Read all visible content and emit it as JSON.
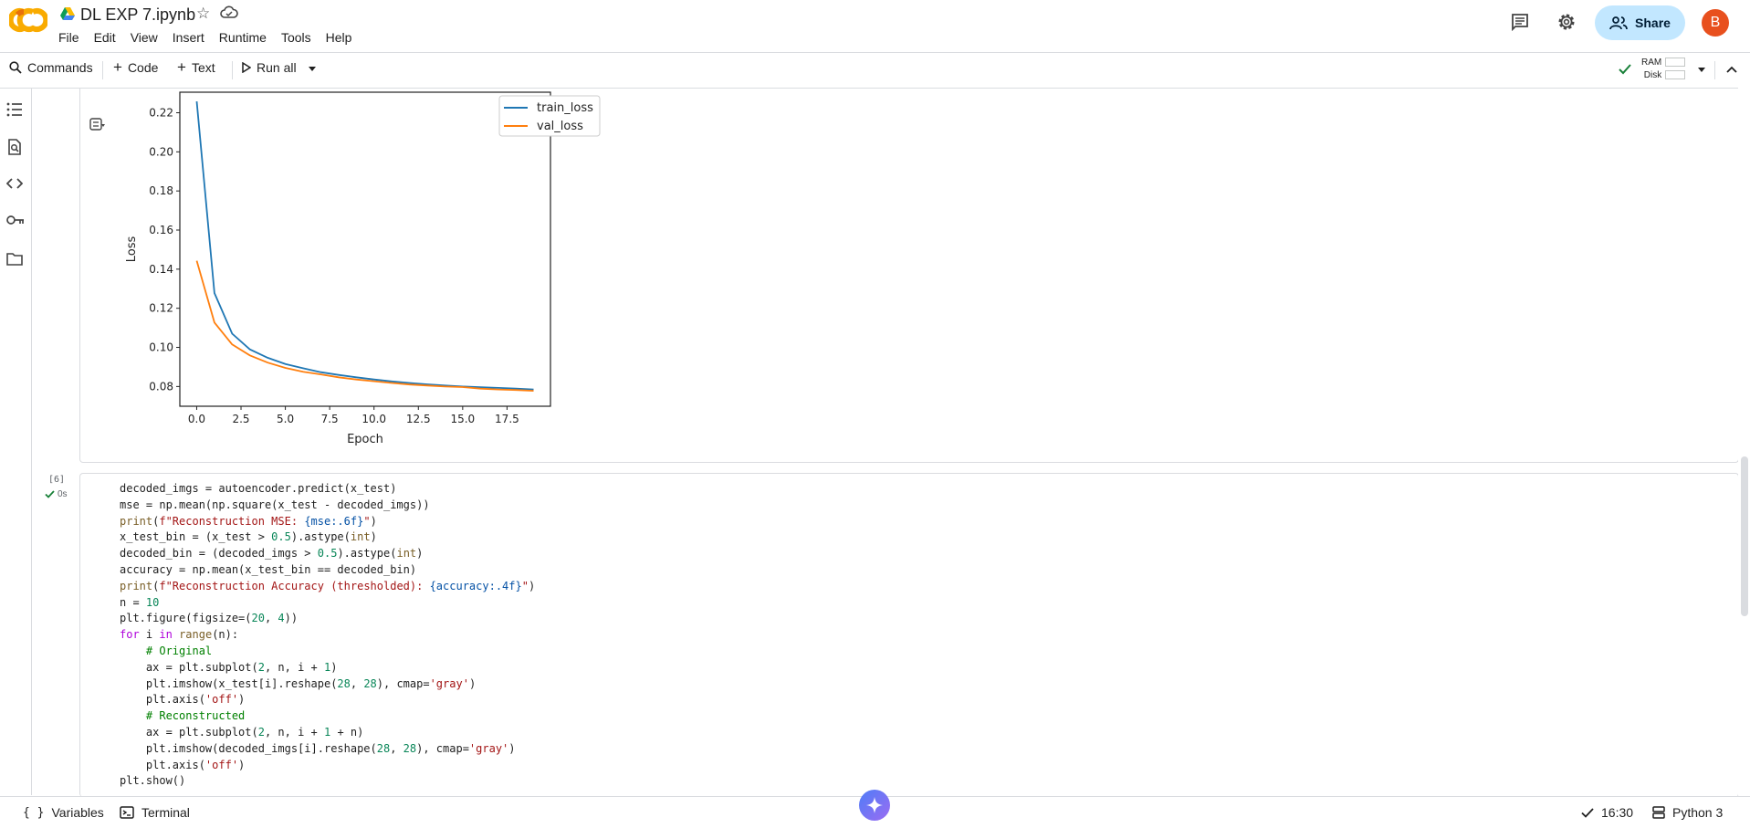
{
  "header": {
    "title": "DL EXP 7.ipynb",
    "menu": [
      "File",
      "Edit",
      "View",
      "Insert",
      "Runtime",
      "Tools",
      "Help"
    ],
    "share_label": "Share",
    "avatar_letter": "B"
  },
  "toolbar": {
    "commands": "Commands",
    "code": "Code",
    "text": "Text",
    "run_all": "Run all",
    "ram": "RAM",
    "disk": "Disk"
  },
  "cell": {
    "count": "[6]",
    "time": "0s"
  },
  "code_lines": [
    "decoded_imgs = autoencoder.predict(x_test)",
    "mse = np.mean(np.square(x_test - decoded_imgs))",
    "print(f\"Reconstruction MSE: {mse:.6f}\")",
    "x_test_bin = (x_test > 0.5).astype(int)",
    "decoded_bin = (decoded_imgs > 0.5).astype(int)",
    "accuracy = np.mean(x_test_bin == decoded_bin)",
    "print(f\"Reconstruction Accuracy (thresholded): {accuracy:.4f}\")",
    "n = 10",
    "plt.figure(figsize=(20, 4))",
    "for i in range(n):",
    "    # Original",
    "    ax = plt.subplot(2, n, i + 1)",
    "    plt.imshow(x_test[i].reshape(28, 28), cmap='gray')",
    "    plt.axis('off')",
    "    # Reconstructed",
    "    ax = plt.subplot(2, n, i + 1 + n)",
    "    plt.imshow(decoded_imgs[i].reshape(28, 28), cmap='gray')",
    "    plt.axis('off')",
    "plt.show()"
  ],
  "statusbar": {
    "variables": "Variables",
    "terminal": "Terminal",
    "time": "16:30",
    "runtime": "Python 3"
  },
  "colors": {
    "train": "#1f77b4",
    "val": "#ff7f0e",
    "share_bg": "#c2e7ff",
    "avatar_bg": "#e8501e"
  },
  "chart_data": {
    "type": "line",
    "xlabel": "Epoch",
    "ylabel": "Loss",
    "xlim": [
      -0.95,
      19.95
    ],
    "ylim": [
      0.0699,
      0.2305
    ],
    "xticks": [
      0.0,
      2.5,
      5.0,
      7.5,
      10.0,
      12.5,
      15.0,
      17.5
    ],
    "xtick_labels": [
      "0.0",
      "2.5",
      "5.0",
      "7.5",
      "10.0",
      "12.5",
      "15.0",
      "17.5"
    ],
    "yticks": [
      0.08,
      0.1,
      0.12,
      0.14,
      0.16,
      0.18,
      0.2,
      0.22
    ],
    "ytick_labels": [
      "0.08",
      "0.10",
      "0.12",
      "0.14",
      "0.16",
      "0.18",
      "0.20",
      "0.22"
    ],
    "legend_position": "top-right",
    "grid": false,
    "x": [
      0,
      1,
      2,
      3,
      4,
      5,
      6,
      7,
      8,
      9,
      10,
      11,
      12,
      13,
      14,
      15,
      16,
      17,
      18,
      19
    ],
    "series": [
      {
        "name": "train_loss",
        "values": [
          0.2258,
          0.1278,
          0.107,
          0.099,
          0.0947,
          0.0915,
          0.0893,
          0.0873,
          0.0859,
          0.0847,
          0.0836,
          0.0826,
          0.0818,
          0.0811,
          0.0805,
          0.08,
          0.0796,
          0.0793,
          0.0789,
          0.0785
        ]
      },
      {
        "name": "val_loss",
        "values": [
          0.1443,
          0.1127,
          0.1015,
          0.0959,
          0.0922,
          0.0895,
          0.0875,
          0.0862,
          0.0847,
          0.0836,
          0.0827,
          0.0818,
          0.081,
          0.0805,
          0.08,
          0.0797,
          0.0789,
          0.0785,
          0.0782,
          0.0778
        ]
      }
    ]
  }
}
